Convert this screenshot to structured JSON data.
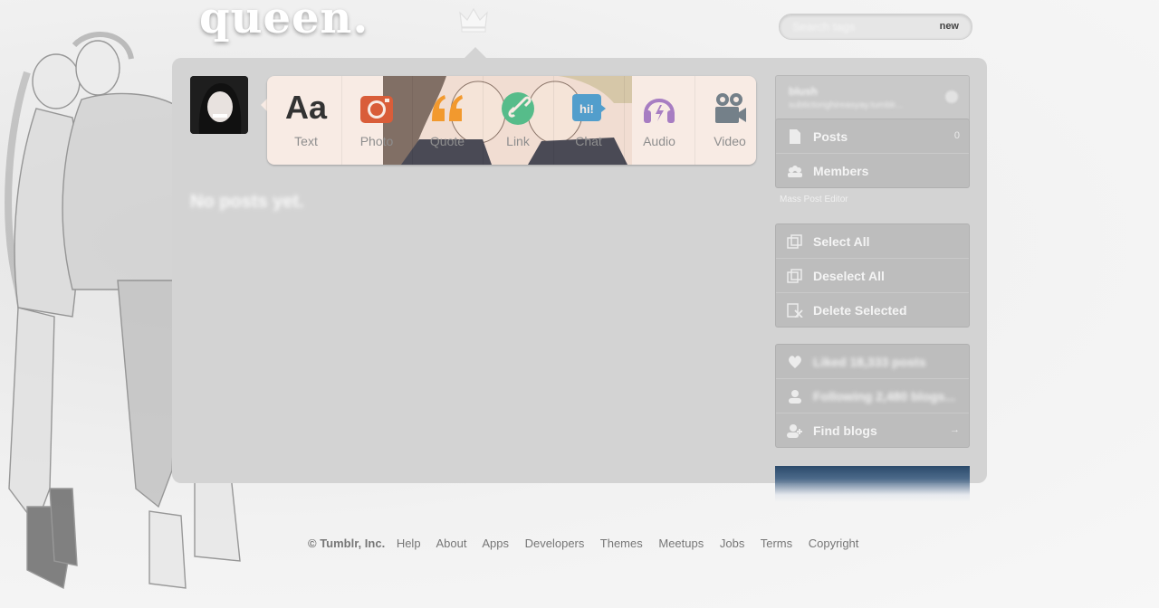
{
  "header": {
    "logo_text": "queen.",
    "crown_icon": "crown-icon",
    "search_placeholder": "Search tags",
    "search_button": "new"
  },
  "post_types": [
    {
      "label": "Text",
      "glyph": "Aa",
      "icon": "text-icon"
    },
    {
      "label": "Photo",
      "icon": "camera-icon",
      "color": "#d95d39"
    },
    {
      "label": "Quote",
      "icon": "quote-icon",
      "color": "#f2992e"
    },
    {
      "label": "Link",
      "icon": "link-icon",
      "color": "#56bc8a"
    },
    {
      "label": "Chat",
      "icon": "chat-icon",
      "color": "#529ecc"
    },
    {
      "label": "Audio",
      "icon": "headphones-icon",
      "color": "#a77dc2"
    },
    {
      "label": "Video",
      "icon": "video-camera-icon",
      "color": "#748089"
    }
  ],
  "main": {
    "empty_message": "No posts yet."
  },
  "sidebar": {
    "blog_name": "blush",
    "blog_url": "subtictorighireasyay.tumblr...",
    "blog_items": [
      {
        "label": "Posts",
        "count": "0",
        "icon": "document-icon"
      },
      {
        "label": "Members",
        "count": "",
        "icon": "members-icon"
      }
    ],
    "mass_post_editor_label": "Mass Post Editor",
    "mass_items": [
      {
        "label": "Select All",
        "icon": "select-all-icon"
      },
      {
        "label": "Deselect All",
        "icon": "deselect-all-icon"
      },
      {
        "label": "Delete Selected",
        "icon": "delete-selected-icon"
      }
    ],
    "account_items": [
      {
        "label": "Liked 18,333 posts",
        "icon": "heart-icon"
      },
      {
        "label": "Following 2,480 blogs...",
        "icon": "person-icon"
      },
      {
        "label": "Find blogs",
        "icon": "add-person-icon",
        "count": "→"
      }
    ]
  },
  "footer": {
    "copyright": "© Tumblr, Inc.",
    "links": [
      "Help",
      "About",
      "Apps",
      "Developers",
      "Themes",
      "Meetups",
      "Jobs",
      "Terms",
      "Copyright"
    ]
  },
  "colors": {
    "panel": "#d3d3d3",
    "sidebar_group": "#bdbdbd",
    "post_bar": "#f8ebe4",
    "dashboard_strip": "#2b4a6b"
  }
}
